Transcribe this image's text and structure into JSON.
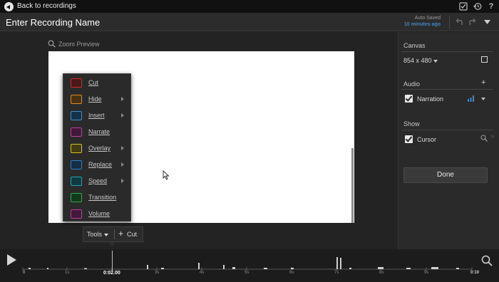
{
  "top_bar": {
    "back_label": "Back to recordings",
    "icons": [
      "task-icon",
      "history-icon",
      "help-icon"
    ]
  },
  "title_bar": {
    "recording_title": "Enter Recording Name",
    "autosave_label": "Auto Saved",
    "autosave_time": "10 minutes ago"
  },
  "preview": {
    "zoom_label": "Zoom Preview"
  },
  "tools_menu": {
    "items": [
      {
        "label": "Cut",
        "color": "#d12b2b",
        "submenu": false
      },
      {
        "label": "Hide",
        "color": "#e28a12",
        "submenu": true
      },
      {
        "label": "Insert",
        "color": "#3a8fd6",
        "submenu": true
      },
      {
        "label": "Narrate",
        "color": "#c23aa0",
        "submenu": false
      },
      {
        "label": "Overlay",
        "color": "#d8c012",
        "submenu": true
      },
      {
        "label": "Replace",
        "color": "#2f7fc9",
        "submenu": true
      },
      {
        "label": "Speed",
        "color": "#18a6b8",
        "submenu": true
      },
      {
        "label": "Transition",
        "color": "#2fa84a",
        "submenu": false
      },
      {
        "label": "Volume",
        "color": "#c23aa0",
        "submenu": false
      }
    ]
  },
  "tools_bar": {
    "tools_label": "Tools",
    "add_cut_label": "Cut"
  },
  "right_panel": {
    "canvas_title": "Canvas",
    "canvas_size": "854 x 480",
    "canvas_checked": false,
    "audio_title": "Audio",
    "narration_label": "Narration",
    "narration_checked": true,
    "show_title": "Show",
    "cursor_label": "Cursor",
    "cursor_checked": true,
    "done_label": "Done"
  },
  "timeline": {
    "start_label": "0",
    "end_label": "0:10",
    "playhead_label": "0:02.00",
    "tick_labels": [
      "1s",
      "2s",
      "3s",
      "4s",
      "5s",
      "6s",
      "7s",
      "8s",
      "9s"
    ]
  }
}
